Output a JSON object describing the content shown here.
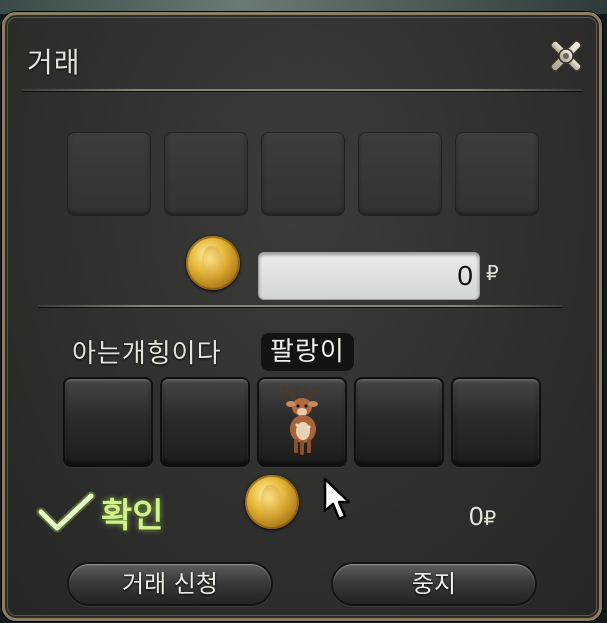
{
  "window": {
    "title": "거래",
    "close_icon": "close-icon"
  },
  "own_offer": {
    "slots": [
      "",
      "",
      "",
      "",
      ""
    ],
    "gil_value": "0",
    "gil_symbol": "₽",
    "coin_icon": "gil-coin-icon"
  },
  "partner_offer": {
    "label": "아는개힝이다",
    "name": "팔랑이",
    "slots": [
      {
        "item": ""
      },
      {
        "item": ""
      },
      {
        "item": "fawn-minion-icon"
      },
      {
        "item": ""
      },
      {
        "item": ""
      }
    ],
    "confirm_label": "확인",
    "confirm_icon": "checkmark-icon",
    "gil_value": "0",
    "gil_symbol": "₽"
  },
  "buttons": {
    "trade": "거래 신청",
    "cancel": "중지"
  },
  "colors": {
    "confirm_green": "#d3f08e",
    "frame_gold": "#8b7f63"
  }
}
